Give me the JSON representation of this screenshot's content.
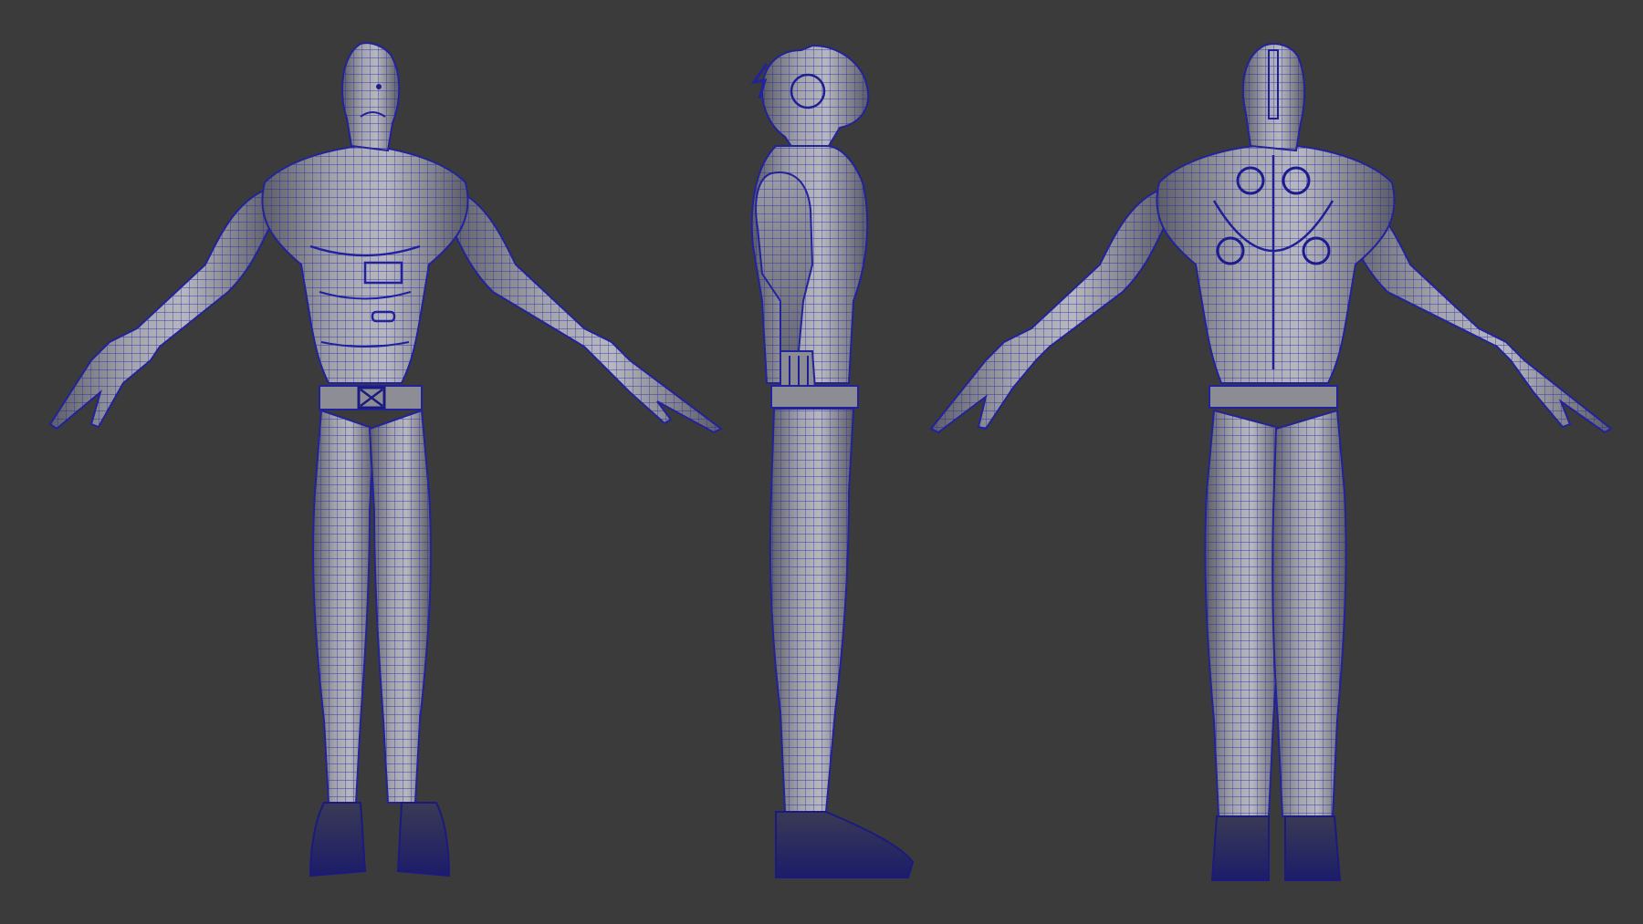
{
  "scene": {
    "background": "#3b3b3b",
    "mesh_fill": "#8e8e96",
    "mesh_shadow": "#5d5d66",
    "wire_color": "#2323a8",
    "views": [
      {
        "id": "front",
        "label": ""
      },
      {
        "id": "side",
        "label": ""
      },
      {
        "id": "back",
        "label": ""
      }
    ]
  }
}
